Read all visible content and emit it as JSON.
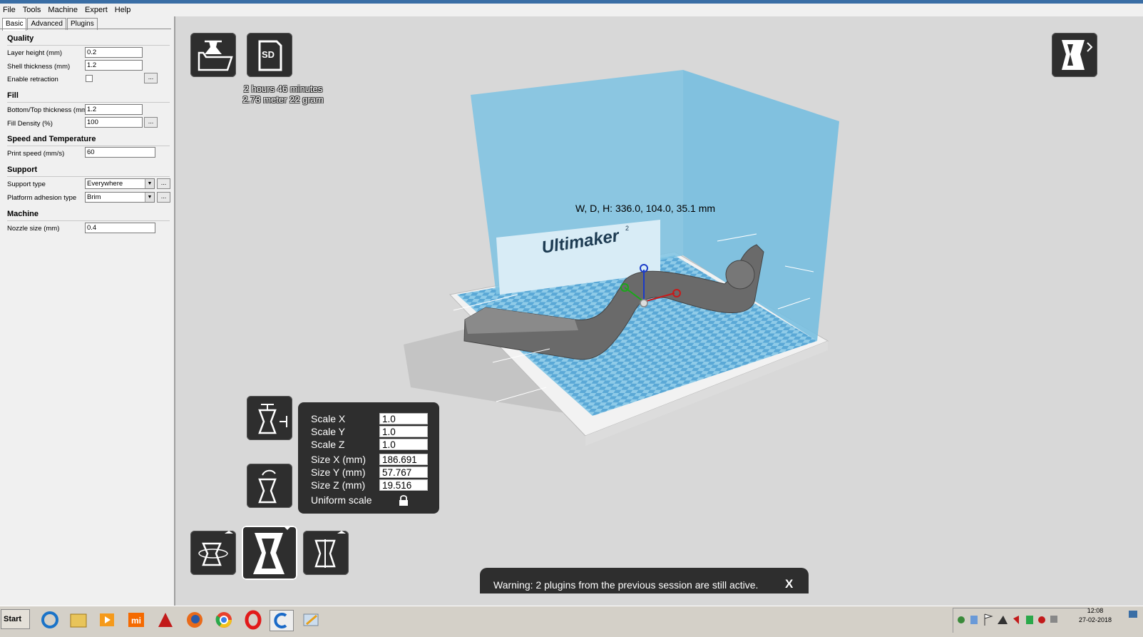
{
  "menu": [
    "File",
    "Tools",
    "Machine",
    "Expert",
    "Help"
  ],
  "tabs": [
    "Basic",
    "Advanced",
    "Plugins"
  ],
  "sections": {
    "quality": "Quality",
    "fill": "Fill",
    "speed": "Speed and Temperature",
    "support": "Support",
    "machine": "Machine"
  },
  "settings": {
    "layer_height": {
      "label": "Layer height (mm)",
      "value": "0.2"
    },
    "shell_thickness": {
      "label": "Shell thickness (mm)",
      "value": "1.2"
    },
    "enable_retraction": {
      "label": "Enable retraction",
      "checked": false
    },
    "bottom_top": {
      "label": "Bottom/Top thickness (mm)",
      "value": "1.2"
    },
    "fill_density": {
      "label": "Fill Density (%)",
      "value": "100"
    },
    "print_speed": {
      "label": "Print speed (mm/s)",
      "value": "60"
    },
    "support_type": {
      "label": "Support type",
      "value": "Everywhere"
    },
    "adhesion": {
      "label": "Platform adhesion type",
      "value": "Brim"
    },
    "nozzle": {
      "label": "Nozzle size (mm)",
      "value": "0.4"
    }
  },
  "dots_label": "...",
  "print_info": {
    "time": "2 hours 46 minutes",
    "material": "2.73 meter 22 gram"
  },
  "sd_label": "SD",
  "dimensions": "W, D, H: 336.0, 104.0, 35.1 mm",
  "brand": "Ultimaker",
  "brand_sup": "2",
  "scale": {
    "scale_x": {
      "label": "Scale X",
      "value": "1.0"
    },
    "scale_y": {
      "label": "Scale Y",
      "value": "1.0"
    },
    "scale_z": {
      "label": "Scale Z",
      "value": "1.0"
    },
    "size_x": {
      "label": "Size X (mm)",
      "value": "186.691"
    },
    "size_y": {
      "label": "Size Y (mm)",
      "value": "57.767"
    },
    "size_z": {
      "label": "Size Z (mm)",
      "value": "19.516"
    },
    "uniform": "Uniform scale"
  },
  "warning": {
    "text": "Warning: 2 plugins from the previous session are still active.",
    "close": "X"
  },
  "taskbar": {
    "start": "Start",
    "time": "12:08",
    "date": "27-02-2018"
  },
  "colors": {
    "build_volume": "#7ec3e3",
    "plate_checker": "#5aa8d6",
    "model": "#555555",
    "panel": "#2e2e2e"
  }
}
